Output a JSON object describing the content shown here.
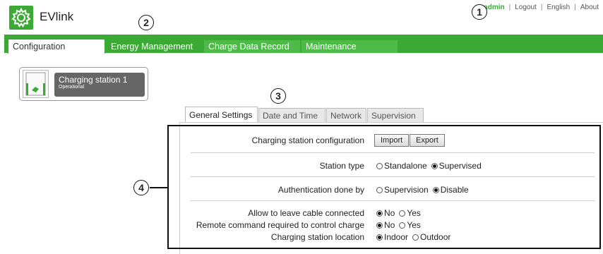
{
  "app": {
    "name": "EVlink"
  },
  "header_links": {
    "admin": "admin",
    "logout": "Logout",
    "language": "English",
    "about": "About",
    "separator": "|"
  },
  "callouts": [
    "1",
    "2",
    "3",
    "4"
  ],
  "nav": {
    "tabs": [
      "Configuration",
      "Energy Management",
      "Charge Data Record",
      "Maintenance"
    ]
  },
  "station": {
    "name": "Charging station 1",
    "status": "Operational"
  },
  "subtabs": [
    "General Settings",
    "Date and Time",
    "Network",
    "Supervision"
  ],
  "settings": {
    "config_label": "Charging station configuration",
    "import_btn": "Import",
    "export_btn": "Export",
    "station_type_label": "Station type",
    "station_type_options": [
      "Standalone",
      "Supervised"
    ],
    "auth_label": "Authentication done by",
    "auth_options": [
      "Supervision",
      "Disable"
    ],
    "cable_label": "Allow to leave cable connected",
    "cable_options": [
      "No",
      "Yes"
    ],
    "remote_label": "Remote command required to control charge",
    "remote_options": [
      "No",
      "Yes"
    ],
    "location_label": "Charging station location",
    "location_options": [
      "Indoor",
      "Outdoor"
    ]
  },
  "colors": {
    "brand_green": "#3aaa35",
    "station_label_bg": "#666666"
  },
  "icons": {
    "logo": "gear-icon",
    "station": "charging-station-icon"
  }
}
